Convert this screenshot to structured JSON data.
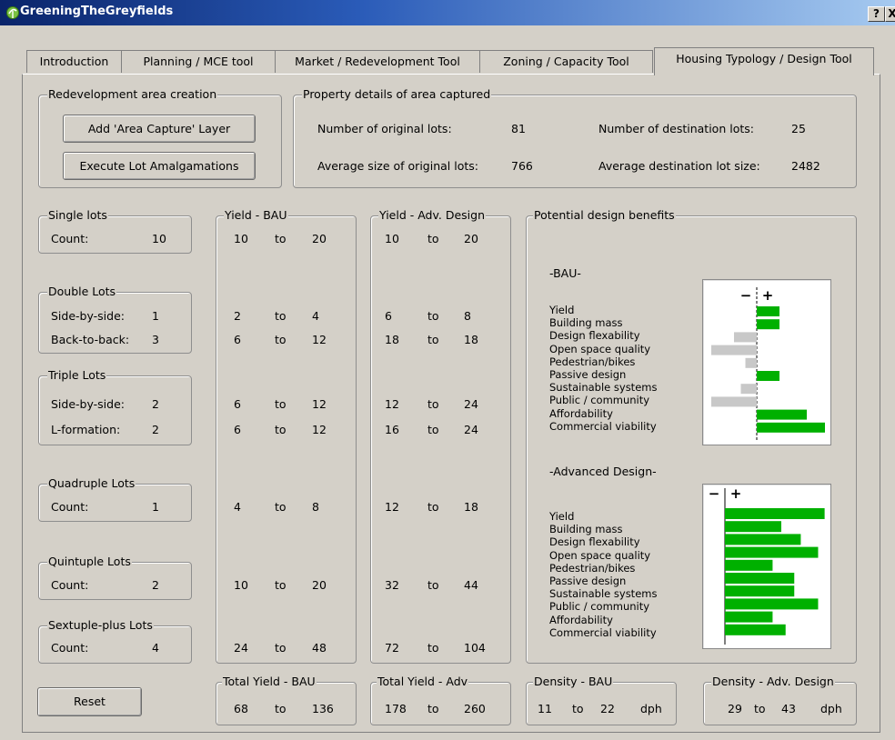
{
  "window": {
    "title": "GreeningTheGreyfields",
    "help_label": "?",
    "close_label": "X"
  },
  "tabs": [
    "Introduction",
    "Planning / MCE tool",
    "Market / Redevelopment  Tool",
    "Zoning / Capacity Tool",
    "Housing Typology / Design Tool"
  ],
  "active_tab": 4,
  "redevelopment": {
    "title": "Redevelopment area creation",
    "add_layer_button": "Add 'Area Capture' Layer",
    "amalgamate_button": "Execute Lot Amalgamations"
  },
  "property": {
    "title": "Property details of area captured",
    "orig_lots_label": "Number of original lots:",
    "orig_lots_value": "81",
    "dest_lots_label": "Number of destination lots:",
    "dest_lots_value": "25",
    "avg_orig_label": "Average size of original lots:",
    "avg_orig_value": "766",
    "avg_dest_label": "Average destination lot size:",
    "avg_dest_value": "2482"
  },
  "lot_groups": [
    {
      "title": "Single lots",
      "rows": [
        {
          "label": "Count:",
          "value": "10"
        }
      ]
    },
    {
      "title": "Double Lots",
      "rows": [
        {
          "label": "Side-by-side:",
          "value": "1"
        },
        {
          "label": "Back-to-back:",
          "value": "3"
        }
      ]
    },
    {
      "title": "Triple Lots",
      "rows": [
        {
          "label": "Side-by-side:",
          "value": "2"
        },
        {
          "label": "L-formation:",
          "value": "2"
        }
      ]
    },
    {
      "title": "Quadruple Lots",
      "rows": [
        {
          "label": "Count:",
          "value": "1"
        }
      ]
    },
    {
      "title": "Quintuple Lots",
      "rows": [
        {
          "label": "Count:",
          "value": "2"
        }
      ]
    },
    {
      "title": "Sextuple-plus Lots",
      "rows": [
        {
          "label": "Count:",
          "value": "4"
        }
      ]
    }
  ],
  "yield_bau": {
    "title": "Yield - BAU",
    "rows": [
      [
        "10",
        "to",
        "20"
      ],
      [
        "2",
        "to",
        "4"
      ],
      [
        "6",
        "to",
        "12"
      ],
      [
        "6",
        "to",
        "12"
      ],
      [
        "6",
        "to",
        "12"
      ],
      [
        "4",
        "to",
        "8"
      ],
      [
        "10",
        "to",
        "20"
      ],
      [
        "24",
        "to",
        "48"
      ]
    ]
  },
  "yield_adv": {
    "title": "Yield - Adv. Design",
    "rows": [
      [
        "10",
        "to",
        "20"
      ],
      [
        "6",
        "to",
        "8"
      ],
      [
        "18",
        "to",
        "18"
      ],
      [
        "12",
        "to",
        "24"
      ],
      [
        "16",
        "to",
        "24"
      ],
      [
        "12",
        "to",
        "18"
      ],
      [
        "32",
        "to",
        "44"
      ],
      [
        "72",
        "to",
        "104"
      ]
    ]
  },
  "benefits": {
    "title": "Potential design benefits",
    "bau_heading": "-BAU-",
    "adv_heading": "-Advanced Design-",
    "minus": "−",
    "plus": "+",
    "labels": [
      "Yield",
      "Building mass",
      "Design flexability",
      "Open space quality",
      "Pedestrian/bikes",
      "Passive design",
      "Sustainable systems",
      "Public / community",
      "Affordability",
      "Commercial viability"
    ],
    "positive_color": "#00b000",
    "negative_color": "#c8c8c8"
  },
  "chart_data": [
    {
      "type": "bar",
      "title": "-BAU-",
      "orientation": "horizontal",
      "categories": [
        "Yield",
        "Building mass",
        "Design flexability",
        "Open space quality",
        "Pedestrian/bikes",
        "Passive design",
        "Sustainable systems",
        "Public / community",
        "Affordability",
        "Commercial viability"
      ],
      "values": [
        1,
        1,
        -1,
        -2,
        -0.5,
        1,
        -0.7,
        -2,
        2.2,
        3
      ],
      "xlim": [
        -2.2,
        3
      ]
    },
    {
      "type": "bar",
      "title": "-Advanced Design-",
      "orientation": "horizontal",
      "categories": [
        "Yield",
        "Building mass",
        "Design flexability",
        "Open space quality",
        "Pedestrian/bikes",
        "Passive design",
        "Sustainable systems",
        "Public / community",
        "Affordability",
        "Commercial viability"
      ],
      "values": [
        4.6,
        2.6,
        3.5,
        4.3,
        2.2,
        3.2,
        3.2,
        4.3,
        2.2,
        2.8
      ],
      "xlim": [
        0,
        4.7
      ]
    }
  ],
  "reset_button": "Reset",
  "total_bau": {
    "title": "Total Yield - BAU",
    "min": "68",
    "to": "to",
    "max": "136"
  },
  "total_adv": {
    "title": "Total Yield - Adv",
    "min": "178",
    "to": "to",
    "max": "260"
  },
  "density_bau": {
    "title": "Density - BAU",
    "min": "11",
    "to": "to",
    "max": "22",
    "unit": "dph"
  },
  "density_adv": {
    "title": "Density - Adv. Design",
    "min": "29",
    "to": "to",
    "max": "43",
    "unit": "dph"
  }
}
